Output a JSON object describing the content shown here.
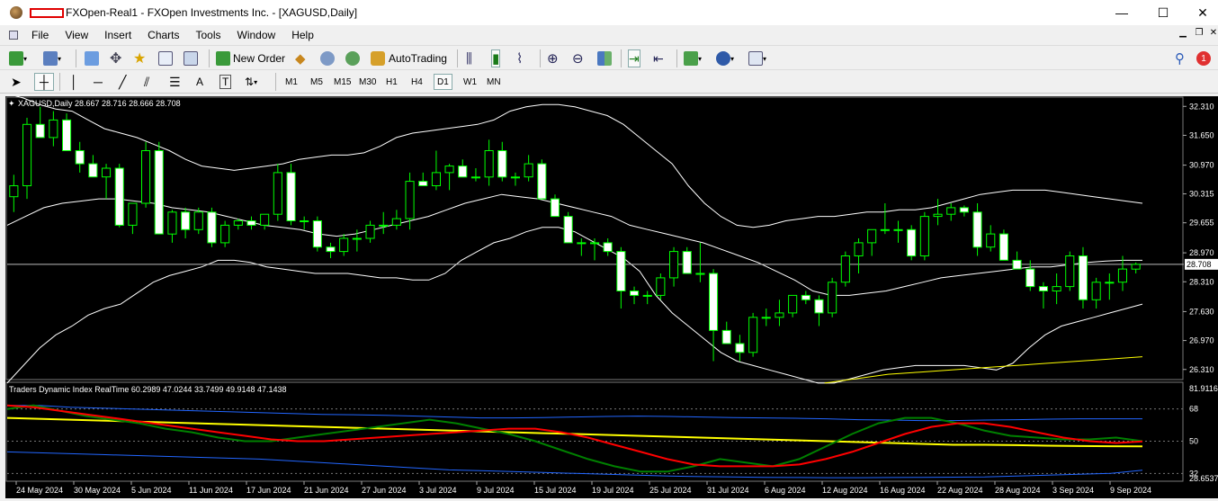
{
  "window": {
    "title": "FXOpen-Real1 - FXOpen Investments Inc. - [XAGUSD,Daily]",
    "minimize": "—",
    "maximize": "☐",
    "close": "✕"
  },
  "menu": [
    "File",
    "View",
    "Insert",
    "Charts",
    "Tools",
    "Window",
    "Help"
  ],
  "toolbar": {
    "new_order_label": "New Order",
    "autotrading_label": "AutoTrading",
    "timeframes": [
      "M1",
      "M5",
      "M15",
      "M30",
      "H1",
      "H4",
      "D1",
      "W1",
      "MN"
    ],
    "active_timeframe": "D1",
    "text_tool_label": "A",
    "notification_count": "1"
  },
  "chart": {
    "header": "XAGUSD,Daily  28.667 28.716 28.666 28.708",
    "current_price": "28.708",
    "price_axis": [
      "32.310",
      "31.650",
      "30.970",
      "30.315",
      "29.655",
      "28.970",
      "28.310",
      "27.630",
      "26.970",
      "26.310"
    ],
    "indicator_header": "Traders Dynamic Index RealTime 60.2989 47.0244 33.7499 49.9148 47.1438",
    "indicator_axis": [
      "81.9116",
      "68",
      "50",
      "32",
      "28.6537"
    ],
    "date_axis": [
      "24 May 2024",
      "30 May 2024",
      "5 Jun 2024",
      "11 Jun 2024",
      "17 Jun 2024",
      "21 Jun 2024",
      "27 Jun 2024",
      "3 Jul 2024",
      "9 Jul 2024",
      "15 Jul 2024",
      "19 Jul 2024",
      "25 Jul 2024",
      "31 Jul 2024",
      "6 Aug 2024",
      "12 Aug 2024",
      "16 Aug 2024",
      "22 Aug 2024",
      "28 Aug 2024",
      "3 Sep 2024",
      "9 Sep 2024"
    ],
    "colors": {
      "background": "#000000",
      "bull": "#00ff00",
      "bear": "#ffffff",
      "band": "#ffffff",
      "ma": "#ffff00",
      "rsi": "#008000",
      "signal": "#ff0000",
      "tdi_band": "#2266ff",
      "tdi_base": "#ffff00"
    }
  },
  "chart_data": {
    "type": "candlestick",
    "symbol": "XAGUSD",
    "timeframe": "Daily",
    "ylim": [
      26.1,
      32.5
    ],
    "ohlc": [
      [
        30.25,
        30.75,
        29.9,
        30.5
      ],
      [
        30.5,
        32.05,
        30.2,
        31.9
      ],
      [
        31.9,
        32.3,
        31.6,
        31.6
      ],
      [
        31.6,
        32.2,
        31.4,
        32.0
      ],
      [
        32.0,
        32.15,
        31.3,
        31.3
      ],
      [
        31.3,
        31.5,
        30.8,
        31.0
      ],
      [
        31.0,
        31.2,
        30.7,
        30.7
      ],
      [
        30.7,
        31.0,
        30.2,
        30.9
      ],
      [
        30.9,
        31.0,
        29.55,
        29.6
      ],
      [
        29.6,
        30.1,
        29.4,
        30.1
      ],
      [
        30.1,
        31.5,
        30.0,
        31.3
      ],
      [
        31.3,
        31.5,
        29.4,
        29.4
      ],
      [
        29.4,
        29.95,
        29.2,
        29.9
      ],
      [
        29.9,
        30.0,
        29.3,
        29.5
      ],
      [
        29.5,
        30.0,
        29.4,
        29.9
      ],
      [
        29.9,
        30.0,
        29.1,
        29.2
      ],
      [
        29.2,
        29.7,
        29.1,
        29.6
      ],
      [
        29.6,
        29.75,
        29.5,
        29.7
      ],
      [
        29.7,
        29.8,
        29.5,
        29.6
      ],
      [
        29.6,
        29.85,
        29.5,
        29.85
      ],
      [
        29.85,
        31.0,
        29.7,
        30.8
      ],
      [
        30.8,
        31.0,
        29.6,
        29.7
      ],
      [
        29.7,
        29.8,
        29.5,
        29.7
      ],
      [
        29.7,
        29.8,
        29.0,
        29.1
      ],
      [
        29.1,
        29.2,
        28.85,
        29.0
      ],
      [
        29.0,
        29.4,
        28.9,
        29.3
      ],
      [
        29.3,
        29.5,
        29.0,
        29.3
      ],
      [
        29.3,
        29.7,
        29.2,
        29.6
      ],
      [
        29.6,
        29.9,
        29.4,
        29.6
      ],
      [
        29.6,
        29.95,
        29.5,
        29.75
      ],
      [
        29.75,
        30.8,
        29.5,
        30.6
      ],
      [
        30.6,
        30.8,
        30.5,
        30.5
      ],
      [
        30.5,
        31.3,
        30.4,
        30.8
      ],
      [
        30.8,
        31.0,
        30.4,
        30.95
      ],
      [
        30.95,
        31.1,
        30.7,
        30.7
      ],
      [
        30.7,
        30.9,
        30.6,
        30.7
      ],
      [
        30.7,
        31.55,
        30.5,
        31.3
      ],
      [
        31.3,
        31.5,
        30.6,
        30.7
      ],
      [
        30.7,
        30.8,
        30.5,
        30.7
      ],
      [
        30.7,
        31.2,
        30.6,
        31.0
      ],
      [
        31.0,
        31.1,
        30.2,
        30.2
      ],
      [
        30.2,
        30.3,
        29.8,
        29.8
      ],
      [
        29.8,
        29.9,
        29.2,
        29.2
      ],
      [
        29.2,
        29.3,
        28.9,
        29.2
      ],
      [
        29.2,
        29.3,
        28.8,
        29.2
      ],
      [
        29.2,
        29.3,
        28.9,
        29.0
      ],
      [
        29.0,
        29.1,
        27.7,
        28.1
      ],
      [
        28.1,
        28.2,
        27.8,
        28.0
      ],
      [
        28.0,
        28.1,
        27.8,
        28.0
      ],
      [
        28.0,
        28.5,
        27.9,
        28.4
      ],
      [
        28.4,
        29.1,
        28.2,
        29.0
      ],
      [
        29.0,
        29.1,
        28.5,
        28.5
      ],
      [
        28.5,
        29.2,
        28.3,
        28.5
      ],
      [
        28.5,
        28.6,
        26.5,
        27.2
      ],
      [
        27.2,
        27.4,
        26.9,
        26.9
      ],
      [
        26.9,
        27.1,
        26.5,
        26.7
      ],
      [
        26.7,
        27.6,
        26.6,
        27.5
      ],
      [
        27.5,
        27.7,
        27.3,
        27.5
      ],
      [
        27.5,
        27.9,
        27.3,
        27.6
      ],
      [
        27.6,
        28.0,
        27.5,
        28.0
      ],
      [
        28.0,
        28.1,
        27.8,
        27.9
      ],
      [
        27.9,
        28.0,
        27.3,
        27.6
      ],
      [
        27.6,
        28.4,
        27.5,
        28.3
      ],
      [
        28.3,
        29.0,
        28.2,
        28.9
      ],
      [
        28.9,
        29.3,
        28.5,
        29.2
      ],
      [
        29.2,
        29.5,
        28.9,
        29.5
      ],
      [
        29.5,
        30.1,
        29.4,
        29.5
      ],
      [
        29.5,
        29.7,
        29.2,
        29.5
      ],
      [
        29.5,
        29.6,
        28.8,
        28.9
      ],
      [
        28.9,
        29.9,
        28.8,
        29.8
      ],
      [
        29.8,
        30.2,
        29.6,
        29.85
      ],
      [
        29.85,
        30.1,
        29.7,
        30.0
      ],
      [
        30.0,
        30.05,
        29.8,
        29.9
      ],
      [
        29.9,
        30.1,
        28.9,
        29.1
      ],
      [
        29.1,
        29.6,
        29.0,
        29.4
      ],
      [
        29.4,
        29.5,
        28.8,
        28.8
      ],
      [
        28.8,
        29.0,
        28.6,
        28.6
      ],
      [
        28.6,
        28.8,
        28.1,
        28.2
      ],
      [
        28.2,
        28.3,
        27.7,
        28.1
      ],
      [
        28.1,
        28.5,
        27.8,
        28.2
      ],
      [
        28.2,
        29.0,
        28.1,
        28.9
      ],
      [
        28.9,
        29.1,
        27.7,
        27.9
      ],
      [
        27.9,
        28.4,
        27.7,
        28.3
      ],
      [
        28.3,
        28.5,
        27.9,
        28.3
      ],
      [
        28.3,
        28.9,
        28.1,
        28.6
      ],
      [
        28.6,
        28.75,
        28.5,
        28.708
      ]
    ],
    "bollinger_upper": [
      32.6,
      32.5,
      32.35,
      32.25,
      32.2,
      32.0,
      31.8,
      31.7,
      31.6,
      31.45,
      31.3,
      31.1,
      30.95,
      30.9,
      30.85,
      30.9,
      30.95,
      31.0,
      31.1,
      31.15,
      31.2,
      31.2,
      31.25,
      31.4,
      31.6,
      31.7,
      31.75,
      31.8,
      31.85,
      31.9,
      32.0,
      32.2,
      32.3,
      32.35,
      32.35,
      32.3,
      32.2,
      32.1,
      31.9,
      31.6,
      31.3,
      31.0,
      30.5,
      30.1,
      29.8,
      29.6,
      29.55,
      29.6,
      29.7,
      29.75,
      29.8,
      29.8,
      29.85,
      29.9,
      29.9,
      29.95,
      29.95,
      30.0,
      30.1,
      30.2,
      30.3,
      30.35,
      30.4,
      30.4,
      30.4,
      30.35,
      30.3,
      30.25,
      30.2,
      30.15,
      30.1
    ],
    "bollinger_mid": [
      29.6,
      29.8,
      30.0,
      30.1,
      30.15,
      30.2,
      30.2,
      30.15,
      30.1,
      30.0,
      29.95,
      29.9,
      29.8,
      29.7,
      29.6,
      29.55,
      29.5,
      29.4,
      29.35,
      29.4,
      29.5,
      29.6,
      29.7,
      29.8,
      29.95,
      30.1,
      30.2,
      30.3,
      30.25,
      30.2,
      30.1,
      30.0,
      29.9,
      29.8,
      29.6,
      29.5,
      29.4,
      29.3,
      29.2,
      29.05,
      28.9,
      28.75,
      28.55,
      28.35,
      28.1,
      28.0,
      28.0,
      28.05,
      28.1,
      28.2,
      28.3,
      28.4,
      28.45,
      28.5,
      28.55,
      28.6,
      28.65,
      28.65,
      28.7,
      28.75,
      28.78,
      28.8,
      28.8
    ],
    "bollinger_lower": [
      26.0,
      26.4,
      26.8,
      27.1,
      27.3,
      27.55,
      27.7,
      27.8,
      28.05,
      28.3,
      28.45,
      28.55,
      28.65,
      28.8,
      28.8,
      28.75,
      28.65,
      28.6,
      28.55,
      28.5,
      28.5,
      28.5,
      28.45,
      28.4,
      28.4,
      28.35,
      28.35,
      28.5,
      28.8,
      29.0,
      29.2,
      29.3,
      29.45,
      29.55,
      29.55,
      29.45,
      29.25,
      29.05,
      28.85,
      28.55,
      28.0,
      27.6,
      27.3,
      27.0,
      26.7,
      26.5,
      26.4,
      26.3,
      26.2,
      26.1,
      26.0,
      26.0,
      26.1,
      26.2,
      26.3,
      26.35,
      26.4,
      26.4,
      26.4,
      26.4,
      26.35,
      26.3,
      26.45,
      26.8,
      27.1,
      27.3,
      27.4,
      27.5,
      27.6,
      27.7,
      27.8
    ],
    "moving_average": [
      26.0,
      26.1,
      26.2,
      26.25,
      26.3,
      26.35,
      26.4,
      26.45,
      26.5,
      26.55,
      26.6
    ],
    "tdi": {
      "ylim": [
        28.65,
        81.91
      ],
      "levels": [
        68,
        50,
        32
      ],
      "upper_band": [
        70,
        70,
        69,
        68.5,
        68,
        67.5,
        67,
        66.5,
        66,
        65.5,
        65,
        64.8,
        64.5,
        64,
        63.5,
        63,
        63,
        63.2,
        63.5,
        63.8,
        64,
        63.8,
        63.5,
        63.2,
        63,
        62.8,
        62.5,
        62,
        61.8,
        61.5,
        61.5,
        61.8,
        62,
        62.3,
        62.5,
        62.5,
        62.5
      ],
      "base": [
        63,
        62.5,
        62,
        61.5,
        61,
        60.5,
        60,
        59.5,
        59,
        58.5,
        58,
        57.5,
        57,
        56.5,
        56,
        55.5,
        55,
        54.5,
        54,
        53.5,
        53,
        52.5,
        52,
        51.5,
        51,
        50.5,
        50,
        49.5,
        49,
        48.5,
        48,
        48,
        47.8,
        47.5,
        47.3,
        47.2,
        47.1
      ],
      "rsi_price_line": [
        68,
        70,
        67,
        64,
        62,
        60,
        57,
        55,
        52,
        50,
        50,
        52,
        54,
        56,
        58,
        60,
        62,
        60,
        57,
        54,
        50,
        45,
        40,
        36,
        33,
        33,
        36,
        40,
        38,
        36,
        40,
        47,
        54,
        60,
        63,
        63,
        60,
        56,
        53,
        52,
        51,
        51,
        52,
        50
      ],
      "signal_line": [
        70,
        69,
        67,
        65,
        63,
        61,
        59,
        57,
        55,
        53,
        51,
        50,
        50,
        51,
        52,
        53,
        54,
        55,
        56,
        57,
        57,
        55,
        52,
        48,
        44,
        40,
        37,
        36,
        36,
        36,
        37,
        40,
        44,
        49,
        54,
        58,
        60,
        60,
        58,
        55,
        52,
        50,
        49,
        49.9
      ],
      "lower_band": [
        44,
        43.5,
        43,
        42.5,
        42,
        41.5,
        41,
        40.5,
        40,
        39,
        38,
        37,
        36,
        35,
        34,
        33.5,
        33,
        32.5,
        32,
        31.5,
        31,
        30.5,
        30.2,
        30,
        29.8,
        29.7,
        29.6,
        29.6,
        29.7,
        29.8,
        29.9,
        30,
        30.5,
        31,
        31.5,
        32,
        33.75
      ]
    }
  }
}
